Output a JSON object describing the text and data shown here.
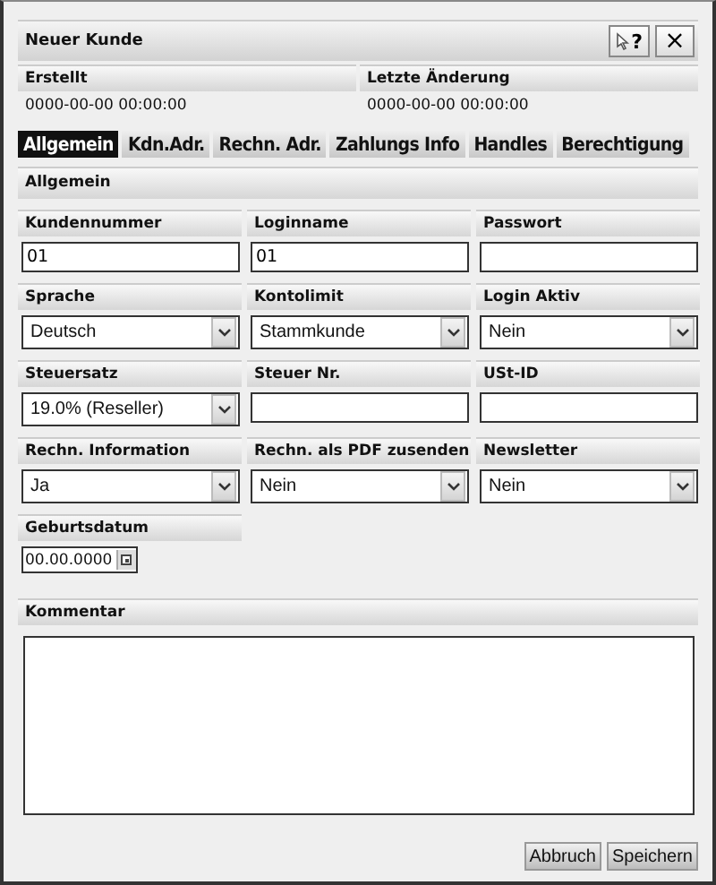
{
  "window": {
    "title": "Neuer Kunde",
    "help_button": "?",
    "close_button": "×"
  },
  "meta": [
    {
      "label": "Erstellt",
      "value": "0000-00-00 00:00:00"
    },
    {
      "label": "Letzte Änderung",
      "value": "0000-00-00 00:00:00"
    }
  ],
  "tabs": [
    {
      "label": "Allgemein",
      "selected": true
    },
    {
      "label": "Kdn.Adr.",
      "selected": false
    },
    {
      "label": "Rechn. Adr.",
      "selected": false
    },
    {
      "label": "Zahlungs Info",
      "selected": false
    },
    {
      "label": "Handles",
      "selected": false
    },
    {
      "label": "Berechtigung",
      "selected": false
    }
  ],
  "section": "Allgemein",
  "field_rows": [
    [
      {
        "label": "Kundennummer",
        "kind": "text",
        "value": "01"
      },
      {
        "label": "Loginname",
        "kind": "text",
        "value": "01"
      },
      {
        "label": "Passwort",
        "kind": "text"
      }
    ],
    [
      {
        "label": "Sprache",
        "kind": "select",
        "value": "Deutsch"
      },
      {
        "label": "Kontolimit",
        "kind": "select",
        "value": "Stammkunde"
      },
      {
        "label": "Login Aktiv",
        "kind": "select",
        "value": "Nein"
      }
    ],
    [
      {
        "label": "Steuersatz",
        "kind": "select",
        "value": "19.0% (Reseller)"
      },
      {
        "label": "Steuer Nr.",
        "kind": "text"
      },
      {
        "label": "USt-ID",
        "kind": "text"
      }
    ],
    [
      {
        "label": "Rechn. Information",
        "kind": "select",
        "value": "Ja"
      },
      {
        "label": "Rechn. als PDF zusenden",
        "kind": "select",
        "value": "Nein"
      },
      {
        "label": "Newsletter",
        "kind": "select",
        "value": "Nein"
      }
    ],
    [
      {
        "label": "Geburtsdatum",
        "kind": "date",
        "value": "00.00.0000"
      }
    ]
  ],
  "comment": {
    "label": "Kommentar"
  },
  "buttons": [
    "Abbruch",
    "Speichern"
  ]
}
